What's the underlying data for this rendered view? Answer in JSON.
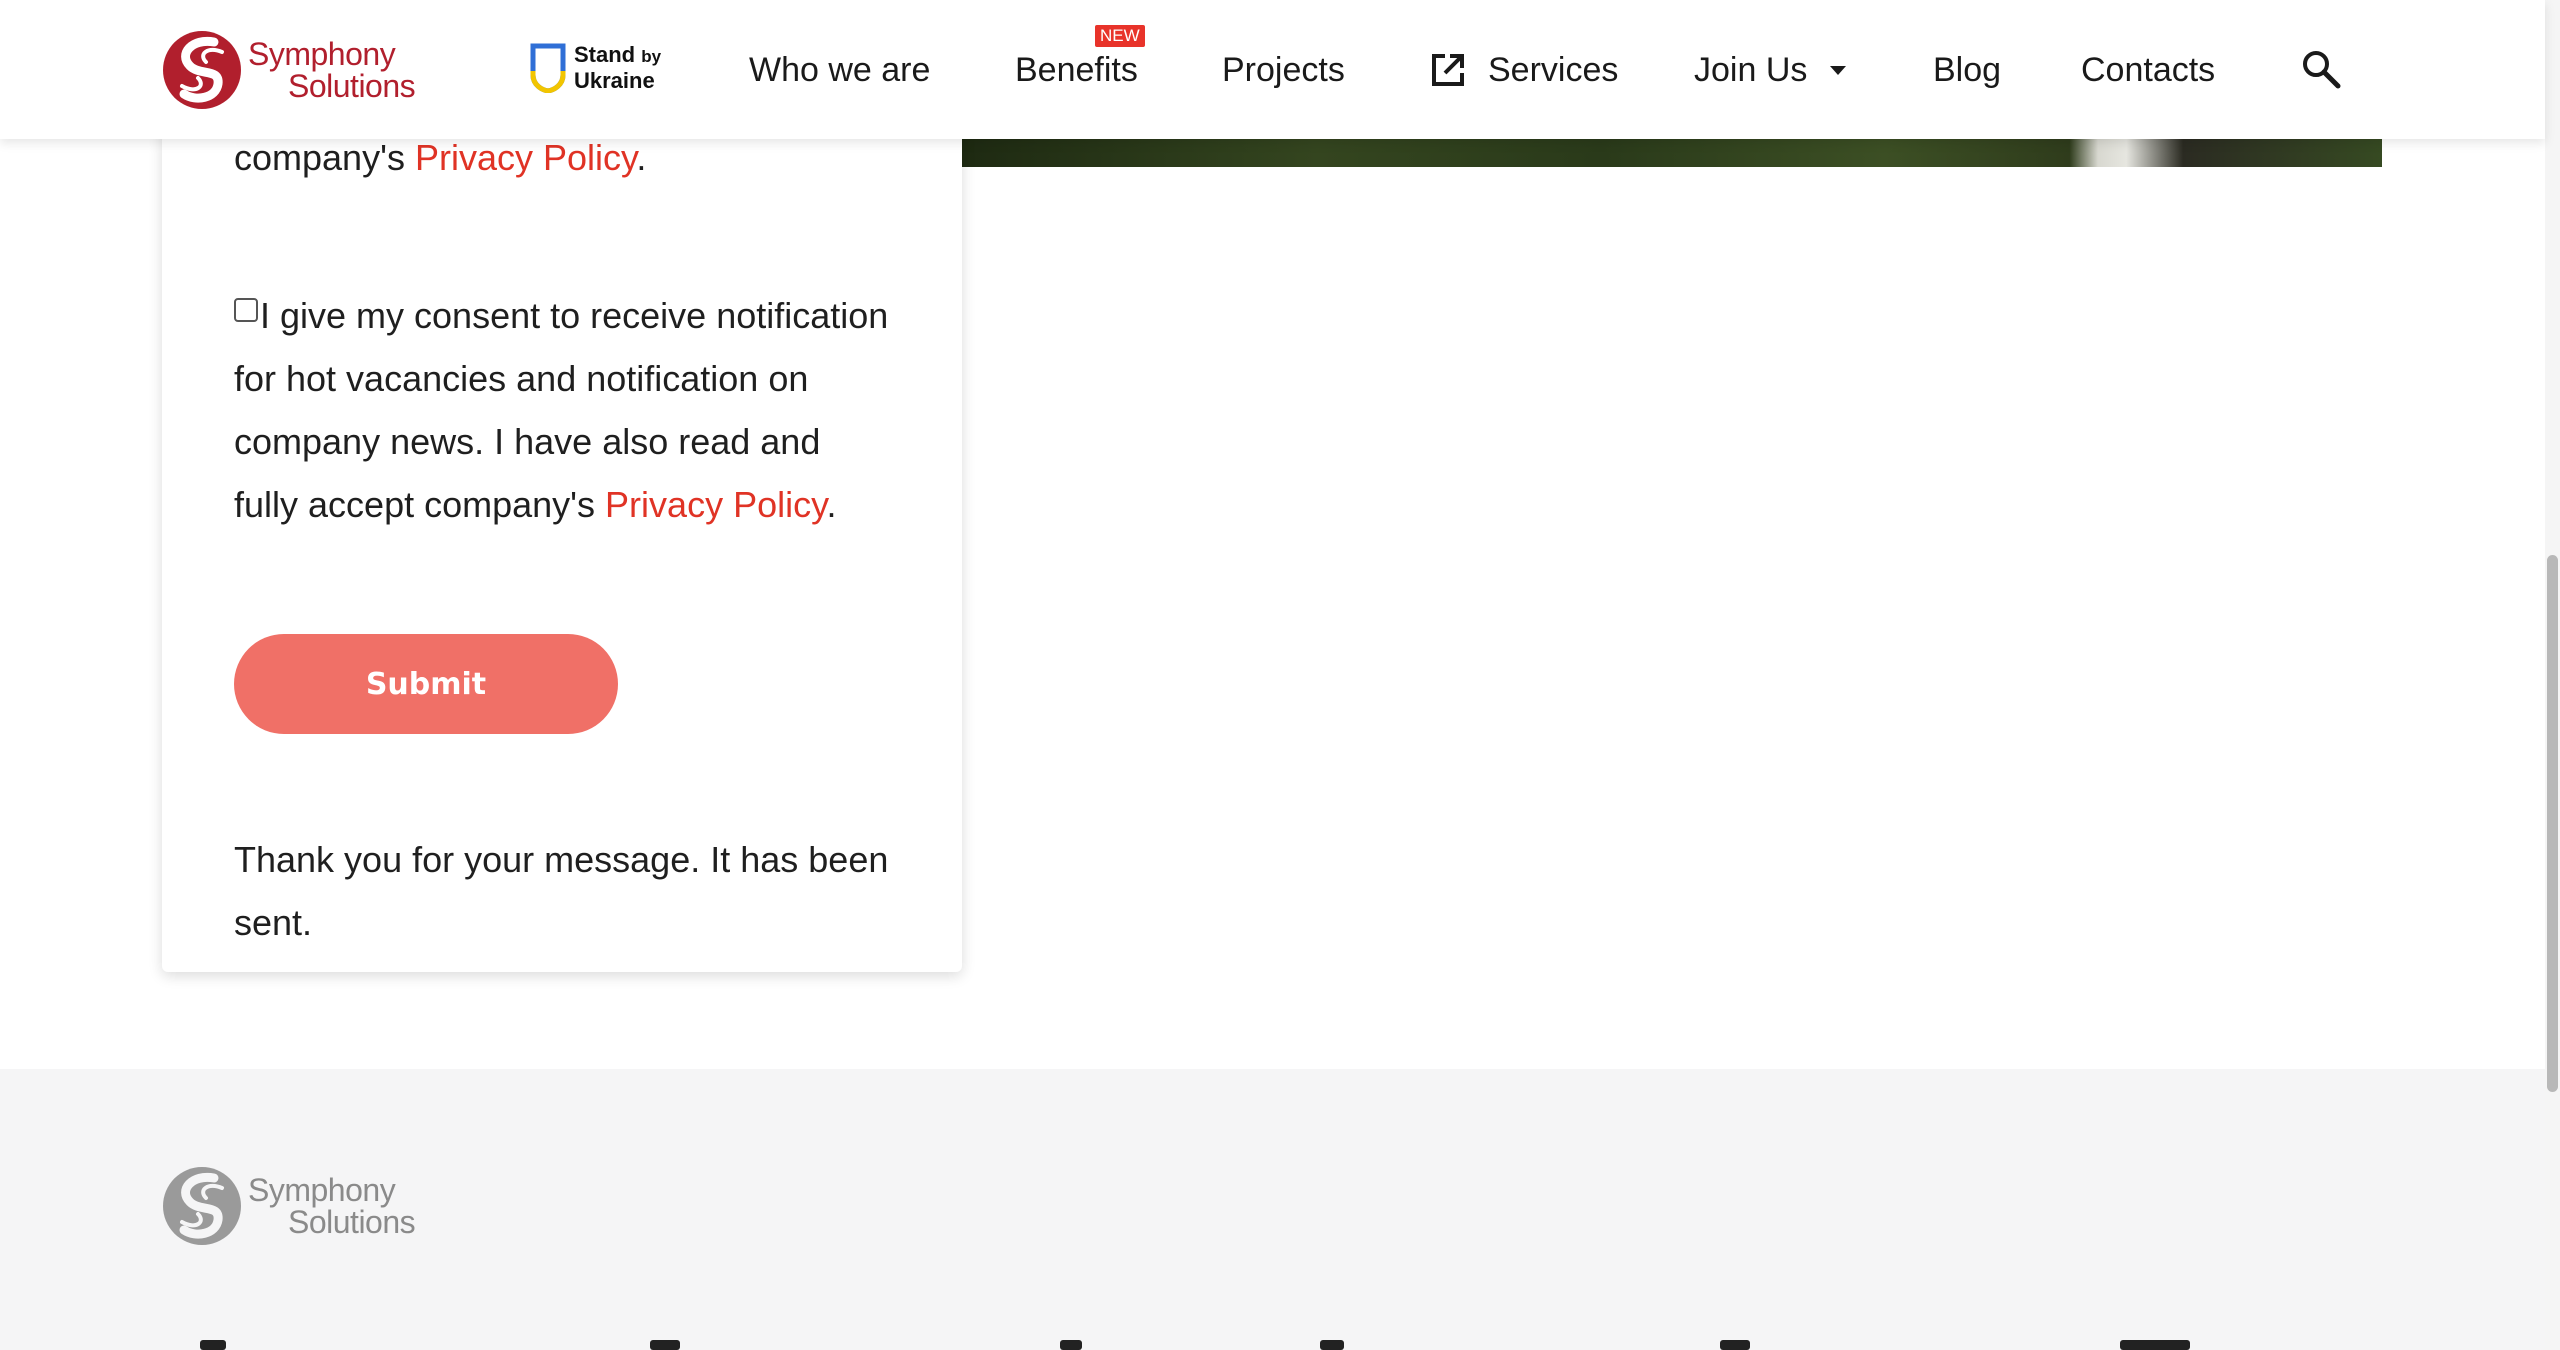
{
  "brand": {
    "logo_line1": "Symphony",
    "logo_line2": "Solutions",
    "color": "#b11f2d"
  },
  "stand_ukraine": {
    "line1": "Stand",
    "by": "by",
    "line2": "Ukraine"
  },
  "nav": {
    "who_we_are": "Who we are",
    "benefits": "Benefits",
    "benefits_badge": "NEW",
    "projects": "Projects",
    "services": "Services",
    "join_us": "Join Us",
    "blog": "Blog",
    "contacts": "Contacts"
  },
  "icons": {
    "external_link": "external-link-icon",
    "dropdown": "chevron-down-icon",
    "search": "search-icon"
  },
  "form": {
    "top_text": "company's ",
    "top_link": "Privacy Policy",
    "top_tail": ".",
    "consent_text": "I give my consent to receive notification for hot vacancies and notification on company news. I have also read and fully accept company's ",
    "consent_link": "Privacy Policy",
    "consent_tail": ".",
    "consent_checked": false,
    "submit_label": "Submit",
    "thank_you": "Thank you for your message. It has been sent."
  },
  "colors": {
    "accent_link": "#e03325",
    "submit_bg": "#f07067",
    "badge_bg": "#e8332a",
    "footer_bg": "#f5f5f6"
  }
}
